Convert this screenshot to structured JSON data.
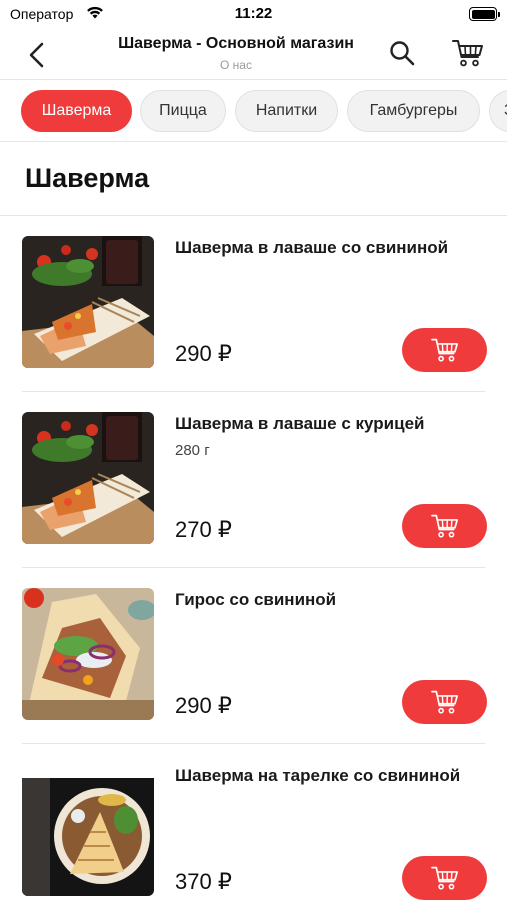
{
  "status_bar": {
    "carrier": "Оператор",
    "time": "11:22"
  },
  "nav": {
    "title": "Шаверма - Основной магазин",
    "subtitle": "О нас",
    "icons": [
      "back-chevron-icon",
      "search-icon",
      "cart-icon"
    ]
  },
  "categories": [
    {
      "label": "Шаверма",
      "active": true
    },
    {
      "label": "Пицца",
      "active": false
    },
    {
      "label": "Напитки",
      "active": false
    },
    {
      "label": "Гамбургеры",
      "active": false
    },
    {
      "label": "З",
      "active": false
    }
  ],
  "section": {
    "title": "Шаверма"
  },
  "products": [
    {
      "name": "Шаверма в лаваше со свининой",
      "weight": "",
      "price": "290 ₽"
    },
    {
      "name": "Шаверма в лаваше с курицей",
      "weight": "280 г",
      "price": "270 ₽"
    },
    {
      "name": "Гирос со свининой",
      "weight": "",
      "price": "290 ₽"
    },
    {
      "name": "Шаверма на тарелке со свининой",
      "weight": "",
      "price": "370 ₽"
    }
  ],
  "colors": {
    "accent": "#ef3b3b",
    "chip_bg": "#f2f2f2",
    "subtitle": "#9a9a9a"
  }
}
